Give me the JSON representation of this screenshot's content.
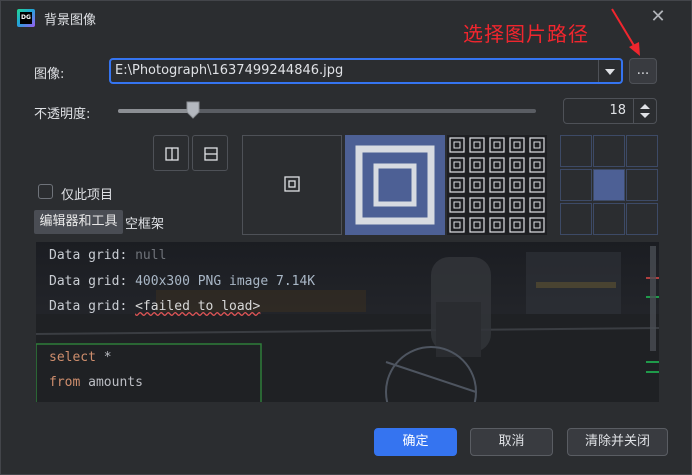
{
  "window": {
    "title": "背景图像",
    "app_icon_text": "DG"
  },
  "annotation": {
    "text": "选择图片路径",
    "color": "#f0262e"
  },
  "image_field": {
    "label": "图像:",
    "value": "E:\\Photograph\\1637499244846.jpg",
    "browse_label": "..."
  },
  "opacity": {
    "label": "不透明度:",
    "value": "18",
    "percent": 18
  },
  "this_project": {
    "label": "仅此项目",
    "checked": false
  },
  "target_tabs": {
    "editor_tools": "编辑器和工具",
    "empty_frame": "空框架"
  },
  "preview": {
    "lines": [
      {
        "key": "Data grid:",
        "value": "null",
        "style": "null"
      },
      {
        "key": "Data grid:",
        "value": "400x300 PNG image 7.14K",
        "style": "val"
      },
      {
        "key": "Data grid:",
        "value": "<failed to load>",
        "style": "err"
      }
    ],
    "sql": [
      {
        "kw": "select",
        "rest": " *"
      },
      {
        "kw": "from",
        "rest": " amounts"
      }
    ]
  },
  "buttons": {
    "ok": "确定",
    "cancel": "取消",
    "clear_close": "清除并关闭"
  },
  "colors": {
    "accent": "#3574f0",
    "selected_tile": "#4d6095",
    "background": "#2b2d30"
  }
}
